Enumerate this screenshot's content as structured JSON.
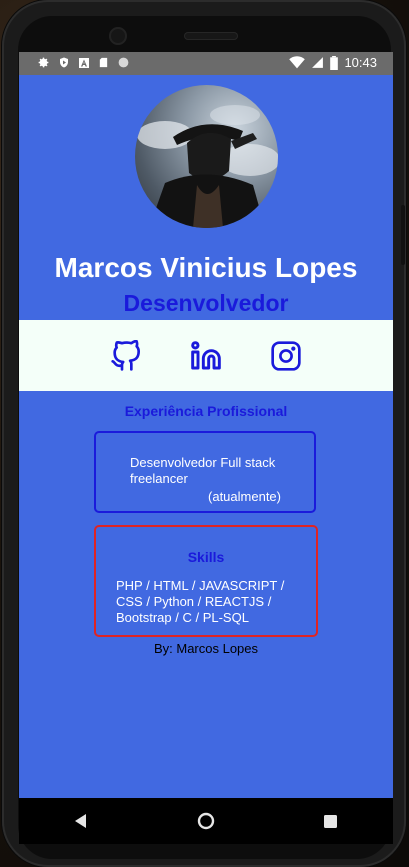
{
  "statusbar": {
    "time": "10:43",
    "left_icons": [
      "gear-icon",
      "shield-icon",
      "app-a-icon",
      "sd-card-icon",
      "circle-icon"
    ],
    "right_icons": [
      "wifi-icon",
      "signal-icon",
      "battery-icon"
    ]
  },
  "profile": {
    "name": "Marcos Vinicius Lopes",
    "role": "Desenvolvedor"
  },
  "social": {
    "links": [
      "github-icon",
      "linkedin-icon",
      "instagram-icon"
    ]
  },
  "experience": {
    "title": "Experiência Profissional",
    "text": "Desenvolvedor Full stack freelancer",
    "note": "(atualmente)"
  },
  "skills": {
    "title": "Skills",
    "text": "PHP / HTML / JAVASCRIPT / CSS / Python / REACTJS / Bootstrap / C / PL-SQL"
  },
  "footer": {
    "byline": "By: Marcos Lopes"
  },
  "colors": {
    "background": "#4169e1",
    "accent_blue": "#1a1adb",
    "skills_border": "#e02424",
    "social_bar": "#f4fff9"
  },
  "navbar": {
    "buttons": [
      "back-icon",
      "home-icon",
      "recents-icon"
    ]
  }
}
